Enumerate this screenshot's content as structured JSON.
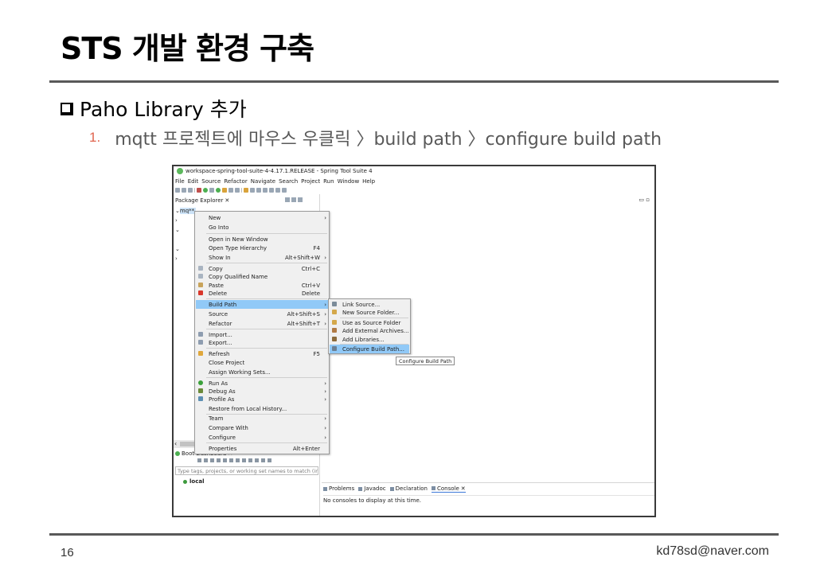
{
  "slide": {
    "title": "STS 개발 환경 구축",
    "bullet": "Paho Library 추가",
    "step_number": "1.",
    "step_text": "mqtt 프로젝트에 마우스 우클릭 〉build path 〉configure build path",
    "page_number": "16",
    "email": "kd78sd@naver.com"
  },
  "ide": {
    "window_title": "workspace-spring-tool-suite-4-4.17.1.RELEASE - Spring Tool Suite 4",
    "menu": [
      "File",
      "Edit",
      "Source",
      "Refactor",
      "Navigate",
      "Search",
      "Project",
      "Run",
      "Window",
      "Help"
    ],
    "package_explorer": {
      "tab_label": "Package Explorer",
      "close": "✕",
      "selected_project": "mq**",
      "tree_arrows": [
        "⌄",
        "›",
        "⌄",
        "⌄",
        "›"
      ]
    },
    "editor_controls": "▭ ▫",
    "boot_dashboard": {
      "tab_label": "Boot Dashboard",
      "close": "✕",
      "filter_placeholder": "Type tags, projects, or working set names to match (incl.",
      "local_label": "local"
    },
    "console": {
      "tabs": [
        "Problems",
        "Javadoc",
        "Declaration",
        "Console"
      ],
      "close": "✕",
      "message": "No consoles to display at this time."
    },
    "context_menu": [
      {
        "label": "New",
        "shortcut": "",
        "arrow": "›"
      },
      {
        "label": "Go Into",
        "shortcut": "",
        "arrow": ""
      },
      {
        "label": "Open in New Window",
        "shortcut": "",
        "arrow": ""
      },
      {
        "label": "Open Type Hierarchy",
        "shortcut": "F4",
        "arrow": ""
      },
      {
        "label": "Show In",
        "shortcut": "Alt+Shift+W",
        "arrow": "›"
      },
      {
        "label": "Copy",
        "shortcut": "Ctrl+C",
        "arrow": ""
      },
      {
        "label": "Copy Qualified Name",
        "shortcut": "",
        "arrow": ""
      },
      {
        "label": "Paste",
        "shortcut": "Ctrl+V",
        "arrow": ""
      },
      {
        "label": "Delete",
        "shortcut": "Delete",
        "arrow": ""
      },
      {
        "label": "Build Path",
        "shortcut": "",
        "arrow": "›"
      },
      {
        "label": "Source",
        "shortcut": "Alt+Shift+S",
        "arrow": "›"
      },
      {
        "label": "Refactor",
        "shortcut": "Alt+Shift+T",
        "arrow": "›"
      },
      {
        "label": "Import...",
        "shortcut": "",
        "arrow": ""
      },
      {
        "label": "Export...",
        "shortcut": "",
        "arrow": ""
      },
      {
        "label": "Refresh",
        "shortcut": "F5",
        "arrow": ""
      },
      {
        "label": "Close Project",
        "shortcut": "",
        "arrow": ""
      },
      {
        "label": "Assign Working Sets...",
        "shortcut": "",
        "arrow": ""
      },
      {
        "label": "Run As",
        "shortcut": "",
        "arrow": "›"
      },
      {
        "label": "Debug As",
        "shortcut": "",
        "arrow": "›"
      },
      {
        "label": "Profile As",
        "shortcut": "",
        "arrow": "›"
      },
      {
        "label": "Restore from Local History...",
        "shortcut": "",
        "arrow": ""
      },
      {
        "label": "Team",
        "shortcut": "",
        "arrow": "›"
      },
      {
        "label": "Compare With",
        "shortcut": "",
        "arrow": "›"
      },
      {
        "label": "Configure",
        "shortcut": "",
        "arrow": "›"
      },
      {
        "label": "Properties",
        "shortcut": "Alt+Enter",
        "arrow": ""
      }
    ],
    "build_path_submenu": [
      {
        "label": "Link Source..."
      },
      {
        "label": "New Source Folder..."
      },
      {
        "label": "Use as Source Folder"
      },
      {
        "label": "Add External Archives..."
      },
      {
        "label": "Add Libraries..."
      },
      {
        "label": "Configure Build Path..."
      }
    ],
    "tooltip": "Configure Build Path",
    "highlight_color": "#91c9f7"
  }
}
